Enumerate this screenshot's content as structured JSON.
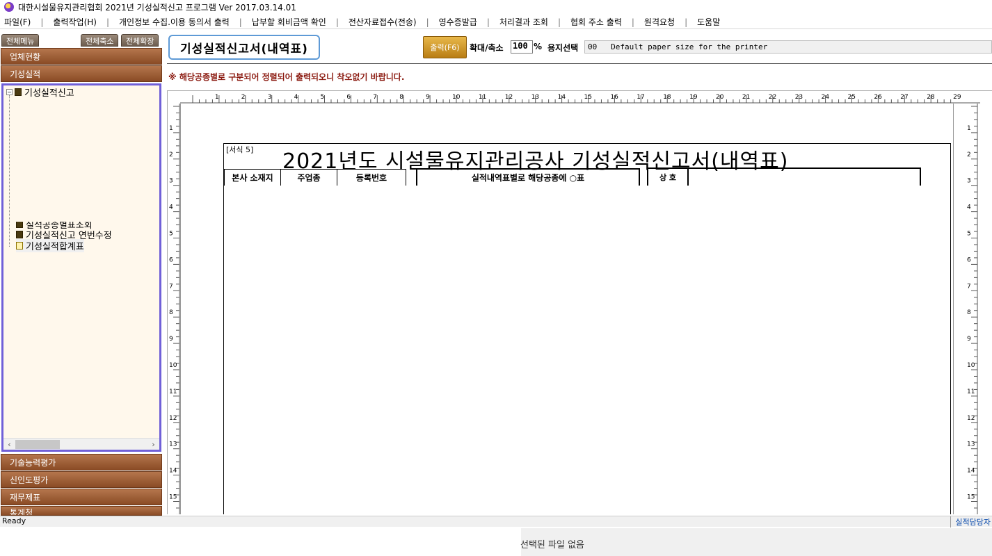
{
  "window": {
    "title": "대한시설물유지관리협회 2021년 기성실적신고 프로그램 Ver 2017.03.14.01"
  },
  "menu": [
    "파일(F)",
    "출력작업(H)",
    "개인정보 수집.이용 동의서 출력",
    "납부할 회비금액 확인",
    "전산자료접수(전송)",
    "영수증발급",
    "처리결과 조회",
    "협회 주소 출력",
    "원격요청",
    "도움말"
  ],
  "left_panel": {
    "tabs": {
      "all_menu": "전체메뉴",
      "collapse_all": "전체축소",
      "expand_all": "전체확장"
    },
    "categories_top": [
      "업체현황",
      "기성실적"
    ],
    "tree": {
      "root": "기성실적신고",
      "items": [
        "실적공종별표조회",
        "기성실적신고 연번수정",
        "기성실적합계표"
      ]
    },
    "categories_bottom": [
      "기술능력평가",
      "신인도평가",
      "재무제표",
      "통계청"
    ]
  },
  "header": {
    "doc_title": "기성실적신고서(내역표)",
    "print_button": "출력(F6)",
    "zoom_label": "확대/축소",
    "zoom_value": "100",
    "zoom_unit": "%",
    "paper_label": "용지선택",
    "paper_value": "00   Default paper size for the printer"
  },
  "notice": "※ 해당공종별로 구분되어 정렬되어 출력되오니 착오없기 바랍니다.",
  "ruler": {
    "h_labels": [
      "1",
      "2",
      "3",
      "4",
      "5",
      "6",
      "7",
      "8",
      "9",
      "10",
      "11",
      "12",
      "13",
      "14",
      "15",
      "16",
      "17",
      "18",
      "19",
      "20",
      "21",
      "22",
      "23",
      "24",
      "25",
      "26",
      "27",
      "28",
      "29"
    ],
    "v_labels": [
      "1",
      "2",
      "3",
      "4",
      "5",
      "6",
      "7",
      "8",
      "9",
      "10",
      "11",
      "12",
      "13",
      "14",
      "15"
    ]
  },
  "form": {
    "number": "[서식 5]",
    "title": "2021년도 시설물유지관리공사 기성실적신고서(내역표)",
    "cells": [
      "본사 소재지",
      "주업종",
      "등록번호",
      "실적내역표별로 해당공종에 ○표",
      "상  호"
    ]
  },
  "status": {
    "left": "Ready",
    "right": "실적담당자"
  },
  "footer": {
    "message": "선택된 파일 없음"
  }
}
